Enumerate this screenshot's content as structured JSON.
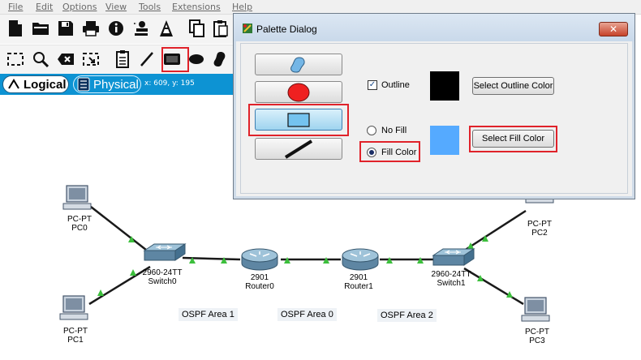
{
  "menu": {
    "items": [
      "File",
      "Edit",
      "Options",
      "View",
      "Tools",
      "Extensions",
      "Help"
    ]
  },
  "toolbar1": {
    "icons": [
      "new-icon",
      "open-icon",
      "save-icon",
      "print-icon",
      "info-icon",
      "wizard-icon",
      "network-info-icon",
      "copy-icon",
      "paste-icon"
    ]
  },
  "toolbar2": {
    "icons": [
      "select-icon",
      "zoom-icon",
      "delete-icon",
      "resize-icon",
      "note-icon",
      "draw-line-icon",
      "draw-rectangle-icon",
      "draw-ellipse-icon",
      "freeform-icon"
    ]
  },
  "modebar": {
    "logical": "Logical",
    "physical": "Physical",
    "coords": "x: 609, y: 195"
  },
  "workspace": {
    "devices": [
      {
        "type": "PC-PT",
        "name": "PC0"
      },
      {
        "type": "PC-PT",
        "name": "PC1"
      },
      {
        "type": "2960-24TT",
        "name": "Switch0"
      },
      {
        "type": "2901",
        "name": "Router0"
      },
      {
        "type": "2901",
        "name": "Router1"
      },
      {
        "type": "2960-24TT",
        "name": "Switch1"
      },
      {
        "type": "PC-PT",
        "name": "PC2"
      },
      {
        "type": "PC-PT",
        "name": "PC3"
      }
    ],
    "areas": [
      "OSPF Area 1",
      "OSPF Area 0",
      "OSPF Area 2"
    ],
    "link_color": "#1a1a1a",
    "link_light_color": "#3cbf3c"
  },
  "dialog": {
    "title": "Palette Dialog",
    "close": "✕",
    "outline_label": "Outline",
    "outline_checked": true,
    "outline_color": "#000000",
    "select_outline_label": "Select Outline Color",
    "no_fill_label": "No Fill",
    "fill_color_label": "Fill Color",
    "fill_mode": "Fill Color",
    "fill_color": "#55aaff",
    "select_fill_label": "Select Fill Color",
    "shapes": [
      "freeform-shape-icon",
      "ellipse-shape-icon",
      "rectangle-shape-icon",
      "line-shape-icon"
    ],
    "active_shape": "rectangle-shape-icon"
  },
  "highlight_color": "#e0222a"
}
